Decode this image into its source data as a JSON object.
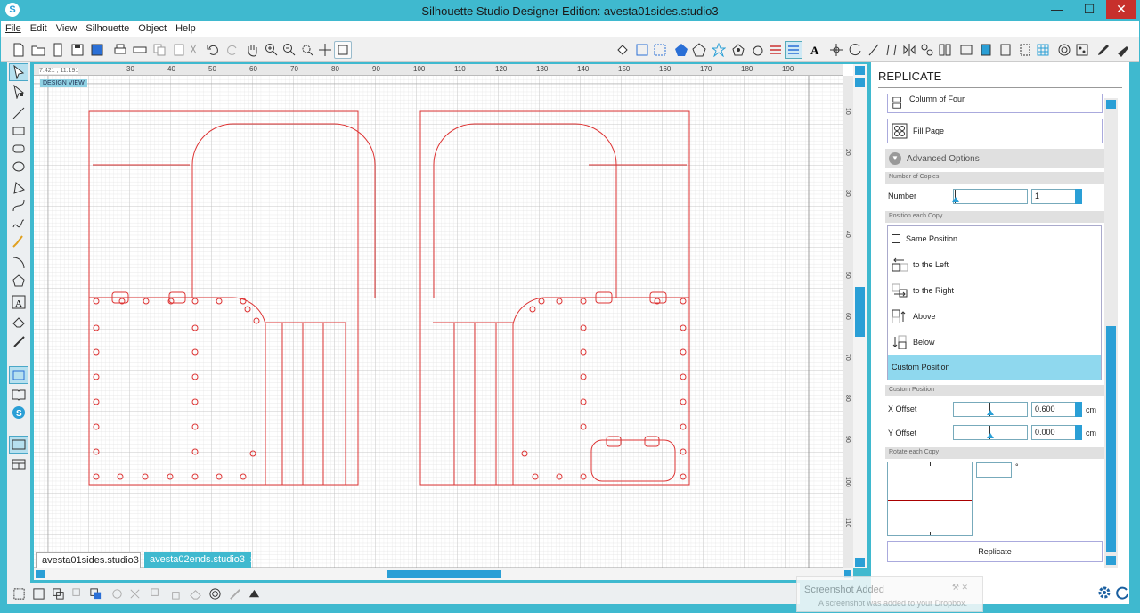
{
  "window": {
    "title": "Silhouette Studio Designer Edition: avesta01sides.studio3",
    "logo": "S",
    "min": "—",
    "max": "☐",
    "close": "✕"
  },
  "menu": [
    "File",
    "Edit",
    "View",
    "Silhouette",
    "Object",
    "Help"
  ],
  "canvas": {
    "coords": "7.421 , 11.191",
    "design_view": "DESIGN VIEW",
    "hruler": [
      "30",
      "40",
      "50",
      "60",
      "70",
      "80",
      "90",
      "100",
      "110",
      "120",
      "130",
      "140",
      "150",
      "160",
      "170",
      "180",
      "190"
    ],
    "vruler": [
      "10",
      "20",
      "30",
      "40",
      "50",
      "60",
      "70",
      "80",
      "90",
      "100",
      "110"
    ]
  },
  "tabs": [
    {
      "label": "avesta01sides.studio3",
      "close": "x"
    },
    {
      "label": "avesta02ends.studio3",
      "close": "x"
    }
  ],
  "panel": {
    "title": "REPLICATE",
    "column_of_four": "Column of Four",
    "fill_page": "Fill Page",
    "advanced_options": "Advanced Options",
    "number_of_copies": "Number of Copies",
    "number_label": "Number",
    "number_value": "1",
    "position_each_copy": "Position each Copy",
    "positions": [
      "Same Position",
      "to the Left",
      "to the Right",
      "Above",
      "Below",
      "Custom Position"
    ],
    "custom_position": "Custom Position",
    "x_offset_label": "X Offset",
    "x_offset": "0.600",
    "x_unit": "cm",
    "y_offset_label": "Y Offset",
    "y_offset": "0.000",
    "y_unit": "cm",
    "rotate_each_copy": "Rotate each Copy",
    "rotate_unit": "°",
    "replicate_button": "Replicate"
  },
  "toast": {
    "title": "Screenshot Added",
    "message": "A screenshot was added to your Dropbox."
  }
}
